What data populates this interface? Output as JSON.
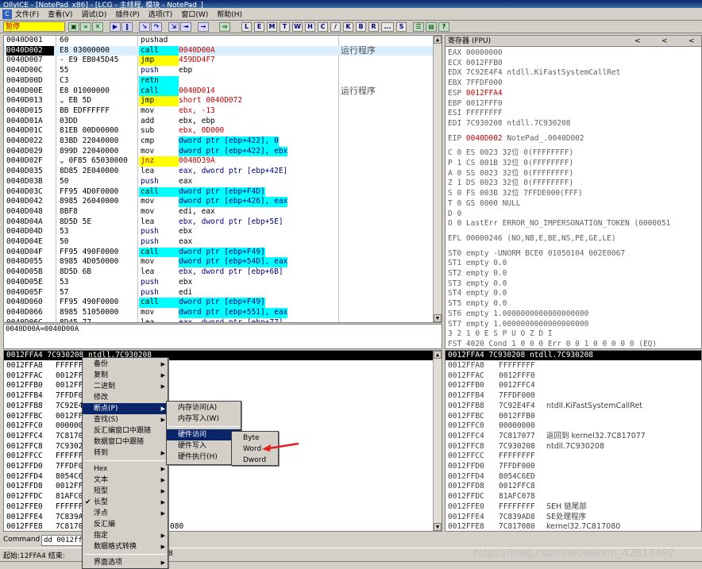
{
  "title": "OllyICE - [NotePad_x86] - [LCG - 主线程, 模块 - NotePad_]",
  "menu": [
    "文件(F)",
    "查看(V)",
    "调试(D)",
    "插件(P)",
    "选项(T)",
    "窗口(W)",
    "帮助(H)"
  ],
  "toolbar": {
    "status": "暂停",
    "buttons": [
      "L",
      "E",
      "M",
      "T",
      "W",
      "H",
      "C",
      "/",
      "K",
      "B",
      "R",
      "...",
      "S"
    ]
  },
  "cpu": {
    "comments": [
      "运行程序",
      "运行程序"
    ],
    "rows": [
      {
        "addr": "0040D001",
        "bytes": "60",
        "mn": "pushad",
        "op": "",
        "type": ""
      },
      {
        "addr": "0040D002",
        "bytes": "E8 03000000",
        "mn": "call",
        "op": "0040D00A",
        "type": "call",
        "sel": true
      },
      {
        "addr": "0040D007",
        "bytes": "- E9 EB045D45",
        "mn": "jmp",
        "op": "459DD4F7",
        "type": "jmp"
      },
      {
        "addr": "0040D00C",
        "bytes": "55",
        "mn": "push",
        "op": "ebp",
        "type": "push"
      },
      {
        "addr": "0040D00D",
        "bytes": "C3",
        "mn": "retn",
        "op": "",
        "type": "retn"
      },
      {
        "addr": "0040D00E",
        "bytes": "E8 01000000",
        "mn": "call",
        "op": "0040D014",
        "type": "call"
      },
      {
        "addr": "0040D013",
        "bytes": "⌄ EB 5D",
        "mn": "jmp",
        "op": "short 0040D072",
        "type": "jmp"
      },
      {
        "addr": "0040D015",
        "bytes": "BB EDFFFFFF",
        "mn": "mov",
        "op": "ebx, -13",
        "type": "red"
      },
      {
        "addr": "0040D01A",
        "bytes": "03DD",
        "mn": "add",
        "op": "ebx, ebp",
        "type": ""
      },
      {
        "addr": "0040D01C",
        "bytes": "81EB 00D00000",
        "mn": "sub",
        "op": "ebx, 0D000",
        "type": "red"
      },
      {
        "addr": "0040D022",
        "bytes": "83BD 22040000",
        "mn": "cmp",
        "op": "dword ptr [ebp+422], 0",
        "type": "mem"
      },
      {
        "addr": "0040D029",
        "bytes": "899D 22040000",
        "mn": "mov",
        "op": "dword ptr [ebp+422], ebx",
        "type": "mem"
      },
      {
        "addr": "0040D02F",
        "bytes": "⌄ 0F85 65030000",
        "mn": "jnz",
        "op": "0040D39A",
        "type": "jnz"
      },
      {
        "addr": "0040D035",
        "bytes": "8D85 2E040000",
        "mn": "lea",
        "op": "eax, dword ptr [ebp+42E]",
        "type": "mem2"
      },
      {
        "addr": "0040D03B",
        "bytes": "50",
        "mn": "push",
        "op": "eax",
        "type": "push"
      },
      {
        "addr": "0040D03C",
        "bytes": "FF95 4D0F0000",
        "mn": "call",
        "op": "dword ptr [ebp+F4D]",
        "type": "callmem"
      },
      {
        "addr": "0040D042",
        "bytes": "8985 26040000",
        "mn": "mov",
        "op": "dword ptr [ebp+426], eax",
        "type": "mem"
      },
      {
        "addr": "0040D048",
        "bytes": "8BF8",
        "mn": "mov",
        "op": "edi, eax",
        "type": ""
      },
      {
        "addr": "0040D04A",
        "bytes": "8D5D 5E",
        "mn": "lea",
        "op": "ebx, dword ptr [ebp+5E]",
        "type": "mem2"
      },
      {
        "addr": "0040D04D",
        "bytes": "53",
        "mn": "push",
        "op": "ebx",
        "type": "push"
      },
      {
        "addr": "0040D04E",
        "bytes": "50",
        "mn": "push",
        "op": "eax",
        "type": "push"
      },
      {
        "addr": "0040D04F",
        "bytes": "FF95 490F0000",
        "mn": "call",
        "op": "dword ptr [ebp+F49]",
        "type": "callmem"
      },
      {
        "addr": "0040D055",
        "bytes": "8985 4D050000",
        "mn": "mov",
        "op": "dword ptr [ebp+54D], eax",
        "type": "mem"
      },
      {
        "addr": "0040D05B",
        "bytes": "8D5D 6B",
        "mn": "lea",
        "op": "ebx, dword ptr [ebp+6B]",
        "type": "mem2"
      },
      {
        "addr": "0040D05E",
        "bytes": "53",
        "mn": "push",
        "op": "ebx",
        "type": "push"
      },
      {
        "addr": "0040D05F",
        "bytes": "57",
        "mn": "push",
        "op": "edi",
        "type": "push"
      },
      {
        "addr": "0040D060",
        "bytes": "FF95 490F0000",
        "mn": "call",
        "op": "dword ptr [ebp+F49]",
        "type": "callmem"
      },
      {
        "addr": "0040D066",
        "bytes": "8985 51050000",
        "mn": "mov",
        "op": "dword ptr [ebp+551], eax",
        "type": "mem"
      },
      {
        "addr": "0040D06C",
        "bytes": "8D45 77",
        "mn": "lea",
        "op": "eax, dword ptr [ebp+77]",
        "type": "mem2"
      }
    ]
  },
  "info_line": "0040D00A=0040D00A",
  "registers": {
    "header": "寄存器 (FPU)",
    "nav": [
      "<",
      "<",
      "<"
    ],
    "lines": [
      {
        "t": "EAX 00000000"
      },
      {
        "t": "ECX 0012FFB0"
      },
      {
        "t": "EDX 7C92E4F4 ntdll.KiFastSystemCallRet"
      },
      {
        "t": "EBX 7FFDF000"
      },
      {
        "t": "ESP ",
        "r": "0012FFA4"
      },
      {
        "t": "EBP 0012FFF0"
      },
      {
        "t": "ESI FFFFFFFF"
      },
      {
        "t": "EDI 7C930208 ntdll.7C930208"
      },
      {
        "t": ""
      },
      {
        "t": "EIP ",
        "r": "0040D002",
        "t2": " NotePad_.0040D002"
      },
      {
        "t": ""
      },
      {
        "t": "C 0   ES 0023 32位 0(FFFFFFFF)"
      },
      {
        "t": "P 1   CS 001B 32位 0(FFFFFFFF)"
      },
      {
        "t": "A 0   SS 0023 32位 0(FFFFFFFF)"
      },
      {
        "t": "Z 1   DS 0023 32位 0(FFFFFFFF)"
      },
      {
        "t": "S 0   FS 003B 32位 7FFDE000(FFF)"
      },
      {
        "t": "T 0   GS 0000 NULL"
      },
      {
        "t": "D 0"
      },
      {
        "t": "O 0   LastErr ERROR_NO_IMPERSONATION_TOKEN (0000051"
      },
      {
        "t": ""
      },
      {
        "t": "EFL 00000246 (NO,NB,E,BE,NS,PE,GE,LE)"
      },
      {
        "t": ""
      },
      {
        "t": "ST0 empty -UNORM BCE0 01050104 002E0067"
      },
      {
        "t": "ST1 empty 0.0"
      },
      {
        "t": "ST2 empty 0.0"
      },
      {
        "t": "ST3 empty 0.0"
      },
      {
        "t": "ST4 empty 0.0"
      },
      {
        "t": "ST5 empty 0.0"
      },
      {
        "t": "ST6 empty 1.0000000000000000000"
      },
      {
        "t": "ST7 empty 1.0000000000000000000"
      },
      {
        "t": "               3 2 1 0      E S P U O Z D I"
      },
      {
        "t": "FST 4020  Cond 1 0 0 0  Err 0 0 1 0 0 0 0 0  (EQ)"
      }
    ]
  },
  "dump": {
    "header": "0012FFA4  7C930208  ntdll.7C930208",
    "rows": [
      {
        "a": "0012FFA8",
        "v": "FFFFFF"
      },
      {
        "a": "0012FFAC",
        "v": "0012FF"
      },
      {
        "a": "0012FFB0",
        "v": "0012FF"
      },
      {
        "a": "0012FFB4",
        "v": "7FFDF0"
      },
      {
        "a": "0012FFB8",
        "v": "7C92E4"
      },
      {
        "a": "0012FFBC",
        "v": "0012FF"
      },
      {
        "a": "0012FFC0",
        "v": "000000"
      },
      {
        "a": "0012FFC4",
        "v": "7C8170"
      },
      {
        "a": "0012FFC8",
        "v": "7C9302"
      },
      {
        "a": "0012FFCC",
        "v": "FFFFFF"
      },
      {
        "a": "0012FFD0",
        "v": "7FFDF0"
      },
      {
        "a": "0012FFD4",
        "v": "8054C6"
      },
      {
        "a": "0012FFD8",
        "v": "0012FF"
      },
      {
        "a": "0012FFDC",
        "v": "81AFC0"
      },
      {
        "a": "0012FFE0",
        "v": "FFFFFF"
      },
      {
        "a": "0012FFE4",
        "v": "7C839A"
      },
      {
        "a": "0012FFE8",
        "v": "7C8170",
        "tail": "080"
      }
    ]
  },
  "stack": {
    "header": "0012FFA4  7C930208  ntdll.7C930208",
    "rows": [
      {
        "a": "0012FFA8",
        "v": "FFFFFFFF",
        "c": ""
      },
      {
        "a": "0012FFAC",
        "v": "0012FFF0",
        "c": ""
      },
      {
        "a": "0012FFB0",
        "v": "0012FFC4",
        "c": ""
      },
      {
        "a": "0012FFB4",
        "v": "7FFDF000",
        "c": ""
      },
      {
        "a": "0012FFB8",
        "v": "7C92E4F4",
        "c": "ntdll.KiFastSystemCallRet"
      },
      {
        "a": "0012FFBC",
        "v": "0012FFB0",
        "c": ""
      },
      {
        "a": "0012FFC0",
        "v": "00000000",
        "c": ""
      },
      {
        "a": "0012FFC4",
        "v": "7C817077",
        "c": "返回到 kernel32.7C817077"
      },
      {
        "a": "0012FFC8",
        "v": "7C930208",
        "c": "ntdll.7C930208"
      },
      {
        "a": "0012FFCC",
        "v": "FFFFFFFF",
        "c": ""
      },
      {
        "a": "0012FFD0",
        "v": "7FFDF000",
        "c": ""
      },
      {
        "a": "0012FFD4",
        "v": "8054C6ED",
        "c": ""
      },
      {
        "a": "0012FFD8",
        "v": "0012FFC8",
        "c": ""
      },
      {
        "a": "0012FFDC",
        "v": "81AFC078",
        "c": ""
      },
      {
        "a": "0012FFE0",
        "v": "FFFFFFFF",
        "c": "SEH 链尾部"
      },
      {
        "a": "0012FFE4",
        "v": "7C839AD8",
        "c": "SE处理程序"
      },
      {
        "a": "0012FFE8",
        "v": "7C817080",
        "c": "kernel32.7C817080"
      }
    ]
  },
  "context_menu": {
    "items": [
      {
        "label": "备份",
        "arrow": true
      },
      {
        "label": "复制",
        "arrow": true
      },
      {
        "label": "二进制",
        "arrow": true
      },
      {
        "label": "修改",
        "arrow": false
      },
      {
        "label": "断点(P)",
        "arrow": true,
        "active": true
      },
      {
        "label": "查找(S)",
        "arrow": true
      },
      {
        "label": "反汇编窗口中跟随",
        "arrow": false
      },
      {
        "label": "数据窗口中跟随",
        "arrow": false
      },
      {
        "label": "转到",
        "arrow": true
      },
      {
        "sep": true
      },
      {
        "label": "Hex",
        "arrow": true
      },
      {
        "label": "文本",
        "arrow": true
      },
      {
        "label": "短型",
        "arrow": true
      },
      {
        "label": "长型",
        "arrow": true,
        "check": true
      },
      {
        "label": "浮点",
        "arrow": true
      },
      {
        "label": "反汇编",
        "arrow": false
      },
      {
        "label": "指定",
        "arrow": true
      },
      {
        "label": "数据格式转换",
        "arrow": true
      },
      {
        "sep": true
      },
      {
        "label": "界面选项",
        "arrow": true
      }
    ]
  },
  "breakpoint_menu": {
    "items": [
      {
        "label": "内存访问(A)"
      },
      {
        "label": "内存写入(W)"
      },
      {
        "sep": true
      },
      {
        "label": "硬件访问",
        "arrow": true,
        "active": true
      },
      {
        "label": "硬件写入",
        "arrow": true
      },
      {
        "label": "硬件执行(H)",
        "arrow": false
      }
    ]
  },
  "hw_access_menu": {
    "items": [
      {
        "label": "Byte"
      },
      {
        "label": "Word"
      },
      {
        "label": "Dword"
      }
    ]
  },
  "command": {
    "label": "Command",
    "value": "dd 0012ffa"
  },
  "status": "起始:12FFA4 结束:",
  "status_tail": "8",
  "watermark": "https://blog.csdn.net/weixin_42813492",
  "colors": {
    "accent_red": "#c00000",
    "selection_blue": "#0a246a",
    "call_cyan": "#00ffff",
    "jmp_yellow": "#ffff00"
  }
}
